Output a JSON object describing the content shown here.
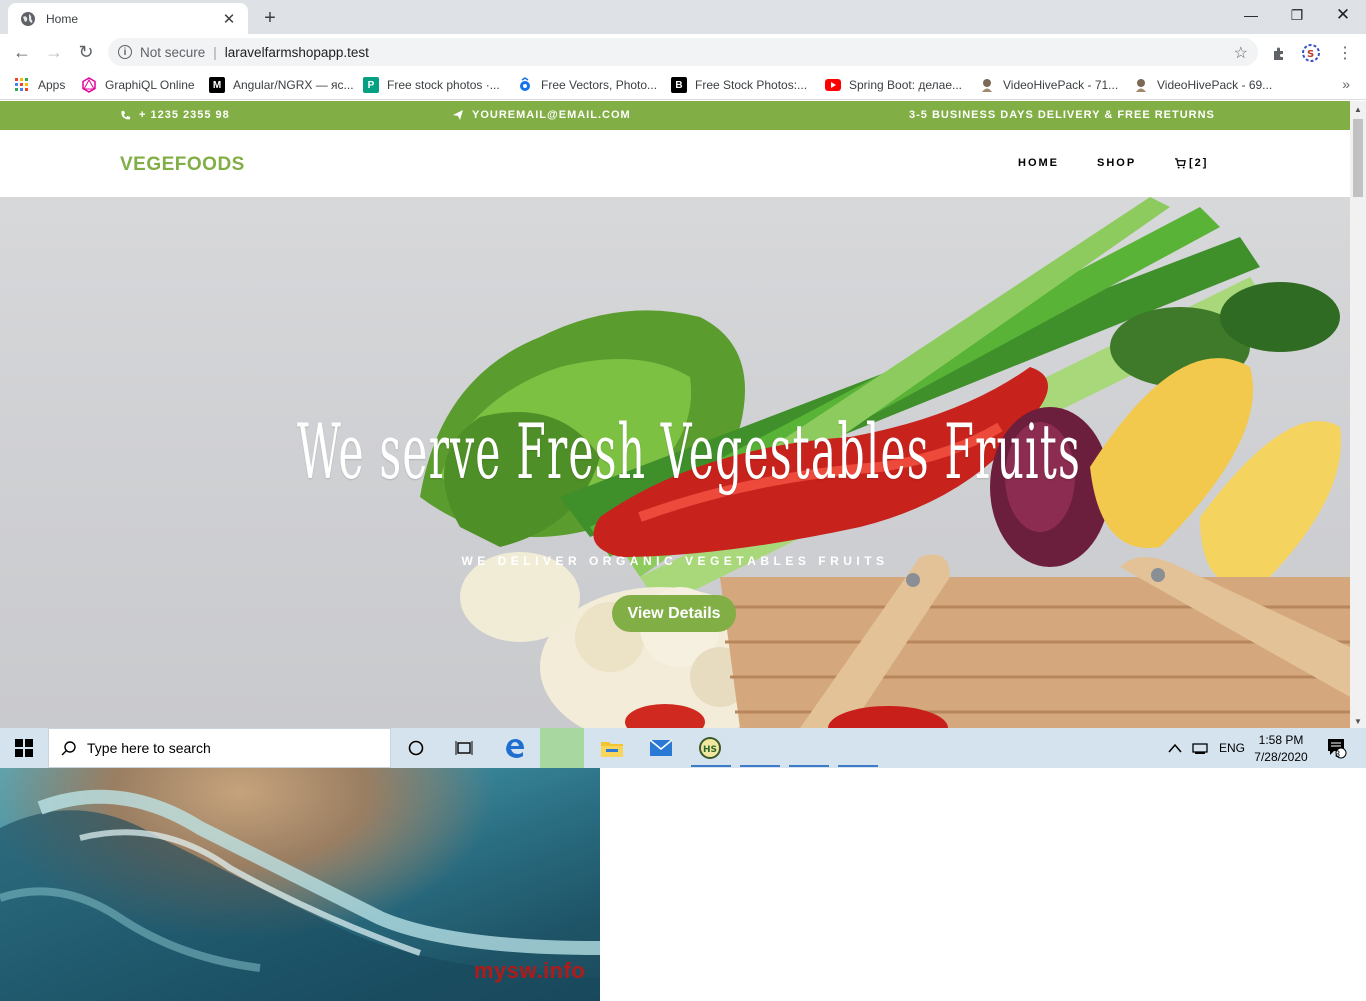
{
  "browser": {
    "tab_title": "Home",
    "omnibox_security": "Not secure",
    "url": "laravelfarmshopapp.test",
    "bookmarks": [
      {
        "label": "Apps",
        "icon": "apps-grid-icon"
      },
      {
        "label": "GraphiQL Online",
        "icon": "graphql-icon"
      },
      {
        "label": "Angular/NGRX — яс...",
        "icon": "medium-icon"
      },
      {
        "label": "Free stock photos ·...",
        "icon": "pexels-icon"
      },
      {
        "label": "Free Vectors, Photo...",
        "icon": "freepik-icon"
      },
      {
        "label": "Free Stock Photos:...",
        "icon": "burst-icon"
      },
      {
        "label": "Spring Boot: делае...",
        "icon": "youtube-icon"
      },
      {
        "label": "VideoHivePack - 71...",
        "icon": "videohive-icon"
      },
      {
        "label": "VideoHivePack - 69...",
        "icon": "videohive-icon"
      }
    ]
  },
  "site": {
    "topbar": {
      "phone": "+ 1235 2355 98",
      "email": "YOUREMAIL@EMAIL.COM",
      "delivery": "3-5 BUSINESS DAYS DELIVERY & FREE RETURNS"
    },
    "brand": "VEGEFOODS",
    "nav": {
      "home": "HOME",
      "shop": "SHOP",
      "cart_count": "[2]"
    },
    "hero": {
      "title": "We serve Fresh Vegestables Fruits",
      "subtitle": "WE DELIVER ORGANIC VEGETABLES FRUITS",
      "button": "View Details"
    },
    "colors": {
      "accent": "#82ae46"
    }
  },
  "taskbar": {
    "search_placeholder": "Type here to search",
    "language": "ENG",
    "time": "1:58 PM",
    "date": "7/28/2020",
    "notification_count": "3"
  },
  "overlay": {
    "watermark": "mysw.info"
  }
}
